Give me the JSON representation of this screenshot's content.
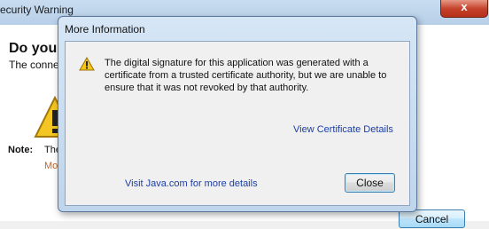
{
  "background_window": {
    "title": "ecurity Warning",
    "close_glyph": "x",
    "heading": "Do you",
    "subtitle": "The conne",
    "note_label": "Note:",
    "note_text": "The",
    "more_link": "Mo",
    "cancel_label": "Cancel",
    "close_button_color": "#c4412a"
  },
  "dialog": {
    "title": "More Information",
    "warning_icon": "warning-triangle-icon",
    "message": "The digital signature for this application was generated with a certificate from a trusted certificate authority, but we are unable to ensure that it was not revoked by that authority.",
    "view_certificate_link": "View Certificate Details",
    "java_link": "Visit Java.com for more details",
    "close_label": "Close",
    "link_color": "#1a3ea8"
  }
}
